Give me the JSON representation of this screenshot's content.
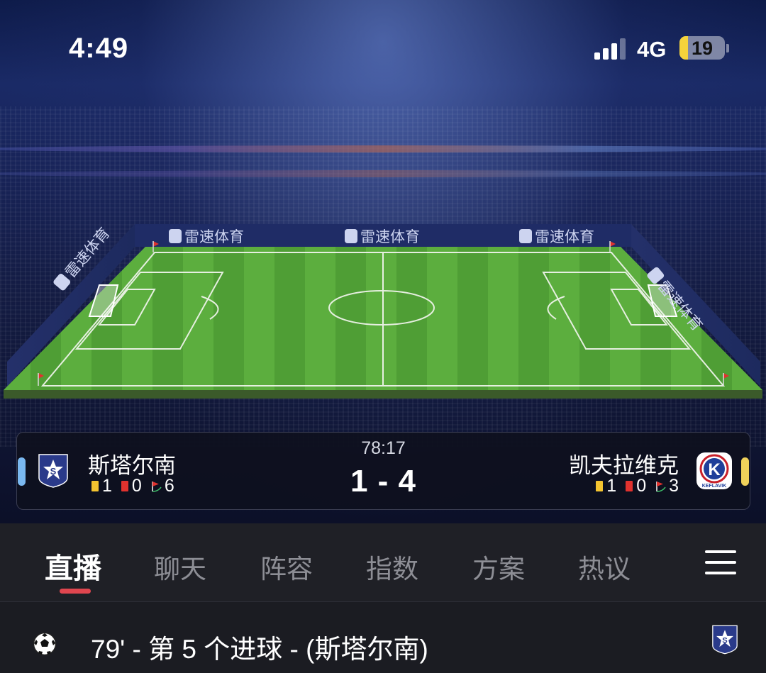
{
  "status_bar": {
    "time": "4:49",
    "network": "4G",
    "battery_level": "19"
  },
  "hero": {
    "ad_board_text": "雷速体育"
  },
  "match": {
    "clock": "78:17",
    "score": "1 - 4",
    "home": {
      "name": "斯塔尔南",
      "crest_letter": "S",
      "yellow_cards": "1",
      "red_cards": "0",
      "corners": "6",
      "indicator_color": "#7ab8f0"
    },
    "away": {
      "name": "凯夫拉维克",
      "crest_letter": "K",
      "crest_text": "KEFLAVIK",
      "yellow_cards": "1",
      "red_cards": "0",
      "corners": "3",
      "indicator_color": "#f0d25a"
    }
  },
  "tabs": [
    {
      "label": "直播",
      "active": true
    },
    {
      "label": "聊天"
    },
    {
      "label": "阵容"
    },
    {
      "label": "指数"
    },
    {
      "label": "方案"
    },
    {
      "label": "热议"
    }
  ],
  "events": [
    {
      "text": "79' - 第 5 个进球 - (斯塔尔南)",
      "icon": "football-icon"
    }
  ],
  "colors": {
    "accent_underline": "#e0464f",
    "pitch_green": "#5aa83c",
    "yellow_card": "#f4c430",
    "red_card": "#e0322e"
  }
}
